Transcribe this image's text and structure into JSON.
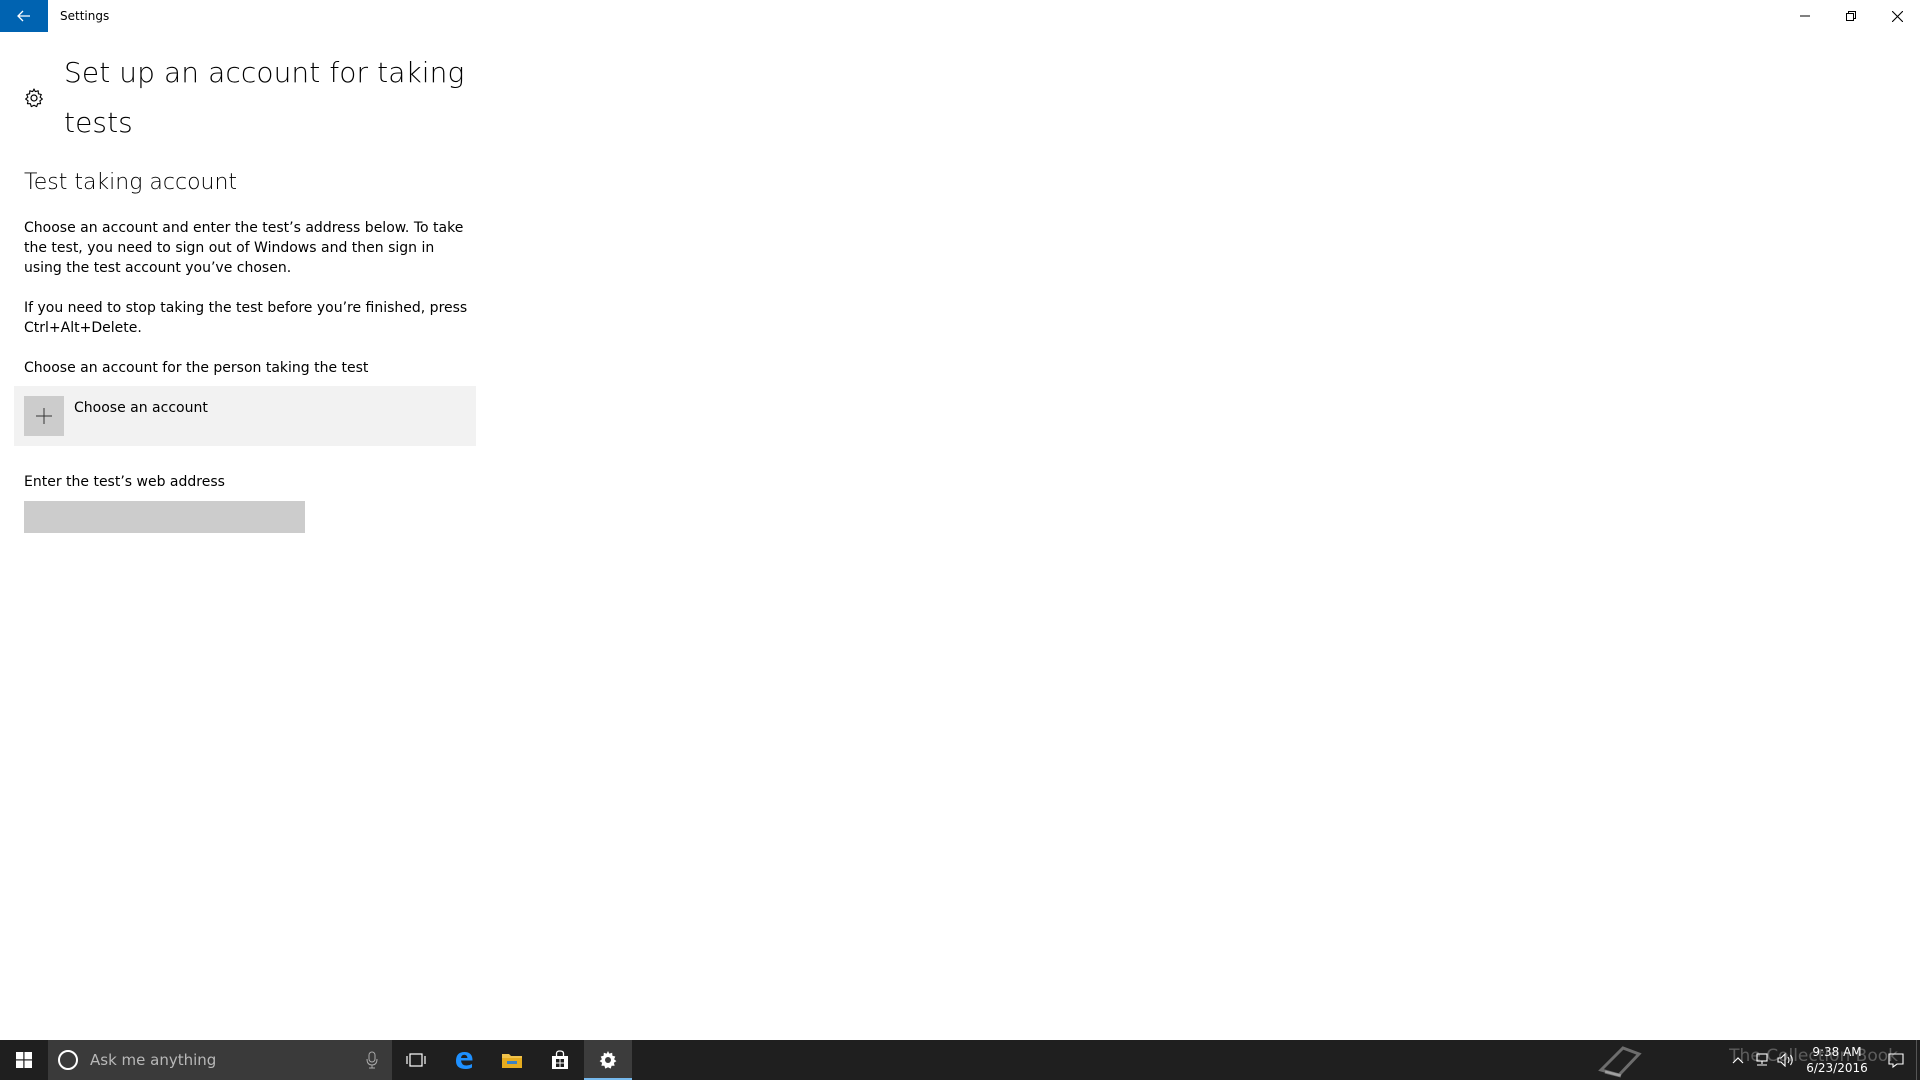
{
  "window": {
    "title": "Settings",
    "back_icon": "back-arrow-icon",
    "accent_color": "#0063b1"
  },
  "page": {
    "title": "Set up an account for taking tests",
    "section_title": "Test taking account",
    "paragraph_1": "Choose an account and enter the test’s address below. To take the test, you need to sign out of Windows and then sign in using the test account you’ve chosen.",
    "paragraph_2": "If you need to stop taking the test before you’re finished, press Ctrl+Alt+Delete.",
    "account_label": "Choose an account for the person taking the test",
    "choose_account_label": "Choose an account",
    "web_address_label": "Enter the test’s web address",
    "web_address_value": ""
  },
  "taskbar": {
    "search_placeholder": "Ask me anything",
    "apps": [
      "task-view",
      "edge",
      "file-explorer",
      "store",
      "settings"
    ],
    "active_app": "settings",
    "time": "9:38 AM",
    "date": "6/23/2016",
    "watermark": "The Collection Book"
  }
}
